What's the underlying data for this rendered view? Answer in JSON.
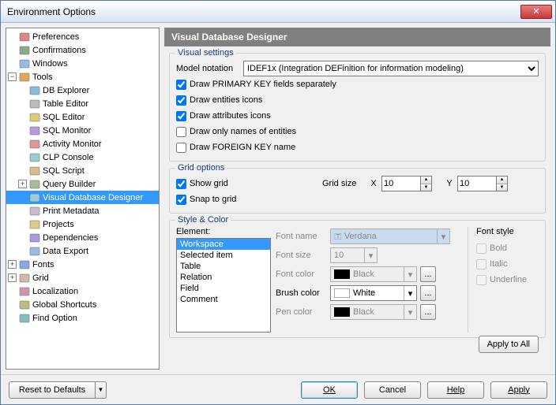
{
  "window": {
    "title": "Environment Options"
  },
  "tree": {
    "items": [
      {
        "label": "Preferences",
        "depth": 1
      },
      {
        "label": "Confirmations",
        "depth": 1
      },
      {
        "label": "Windows",
        "depth": 1
      },
      {
        "label": "Tools",
        "depth": 1,
        "toggle": "−"
      },
      {
        "label": "DB Explorer",
        "depth": 2
      },
      {
        "label": "Table Editor",
        "depth": 2
      },
      {
        "label": "SQL Editor",
        "depth": 2
      },
      {
        "label": "SQL Monitor",
        "depth": 2
      },
      {
        "label": "Activity Monitor",
        "depth": 2
      },
      {
        "label": "CLP Console",
        "depth": 2
      },
      {
        "label": "SQL Script",
        "depth": 2
      },
      {
        "label": "Query Builder",
        "depth": 2,
        "toggle": "+"
      },
      {
        "label": "Visual Database Designer",
        "depth": 2,
        "selected": true
      },
      {
        "label": "Print Metadata",
        "depth": 2
      },
      {
        "label": "Projects",
        "depth": 2
      },
      {
        "label": "Dependencies",
        "depth": 2
      },
      {
        "label": "Data Export",
        "depth": 2
      },
      {
        "label": "Fonts",
        "depth": 1,
        "toggle": "+"
      },
      {
        "label": "Grid",
        "depth": 1,
        "toggle": "+"
      },
      {
        "label": "Localization",
        "depth": 1
      },
      {
        "label": "Global Shortcuts",
        "depth": 1
      },
      {
        "label": "Find Option",
        "depth": 1
      }
    ]
  },
  "header": {
    "title": "Visual Database Designer"
  },
  "visual_settings": {
    "title": "Visual settings",
    "notation_label": "Model notation",
    "notation_value": "IDEF1x (Integration DEFinition for information modeling)",
    "chk_pk": "Draw PRIMARY KEY fields separately",
    "chk_ent": "Draw entities icons",
    "chk_attr": "Draw attributes icons",
    "chk_names": "Draw only names of entities",
    "chk_fk": "Draw FOREIGN KEY name"
  },
  "grid_options": {
    "title": "Grid options",
    "show": "Show grid",
    "snap": "Snap to grid",
    "gridsize_label": "Grid size",
    "x_label": "X",
    "x_value": "10",
    "y_label": "Y",
    "y_value": "10"
  },
  "style": {
    "title": "Style & Color",
    "element_label": "Element:",
    "elements": [
      "Workspace",
      "Selected item",
      "Table",
      "Relation",
      "Field",
      "Comment"
    ],
    "font_name_label": "Font name",
    "font_name": "Verdana",
    "font_size_label": "Font size",
    "font_size": "10",
    "font_color_label": "Font color",
    "font_color": "Black",
    "brush_color_label": "Brush color",
    "brush_color": "White",
    "pen_color_label": "Pen color",
    "pen_color": "Black",
    "font_style_label": "Font style",
    "bold": "Bold",
    "italic": "Italic",
    "underline": "Underline",
    "apply_all": "Apply to All"
  },
  "buttons": {
    "reset": "Reset to Defaults",
    "ok": "OK",
    "cancel": "Cancel",
    "help": "Help",
    "apply": "Apply"
  }
}
